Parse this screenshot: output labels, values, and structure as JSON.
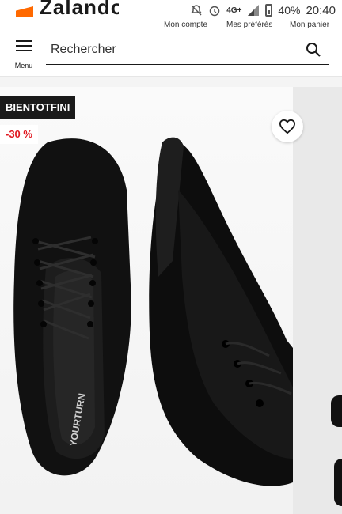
{
  "status_bar": {
    "network": "4G+",
    "battery": "40%",
    "time": "20:40"
  },
  "top_nav": {
    "account": "Mon compte",
    "favorites": "Mes préférés",
    "cart": "Mon panier"
  },
  "header": {
    "menu_label": "Menu",
    "search_placeholder": "Rechercher"
  },
  "product": {
    "badge_label": "BIENTOTFINI",
    "discount": "-30 %",
    "insole_brand": "YOURTURN"
  },
  "colors": {
    "brand_orange": "#ff6900",
    "discount_red": "#e0171f",
    "badge_black": "#1a1a1a"
  },
  "icons": [
    "logo-mark",
    "mute-icon",
    "alarm-icon",
    "signal-icon",
    "battery-icon",
    "menu-icon",
    "search-icon",
    "heart-icon"
  ]
}
